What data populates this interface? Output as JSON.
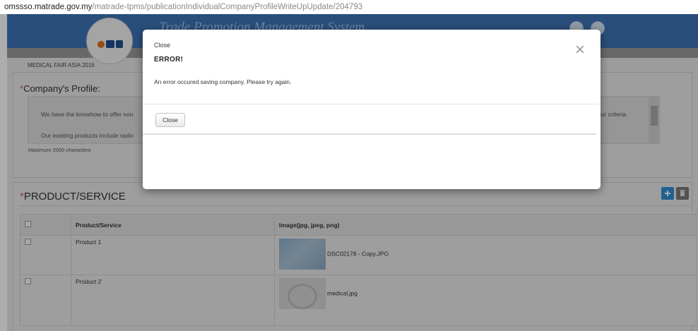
{
  "browser": {
    "url_host": "omssso.matrade.gov.my",
    "url_path": "/matrade-tpms/publicationIndividualCompanyProfileWriteUpUpdate/204793"
  },
  "header": {
    "title": "Trade Promotion Management System"
  },
  "colors": {
    "header_blue": "#3f73b6",
    "required_red": "#d9534f",
    "add_button": "#2e8fd6",
    "delete_button": "#7a7a7a"
  },
  "profile": {
    "event_name": "MEDICAL FAIR ASIA 2016",
    "required_mark": "*",
    "label": "Company's Profile:",
    "lines": [
      "We have the knowhow to offer non",
      "our criteria.",
      "Our existing products include radio"
    ],
    "max_chars": "Maximum 2000 characters"
  },
  "products": {
    "required_mark": "*",
    "title": "PRODUCT/SERVICE",
    "columns": [
      "Product/Service",
      "Image(jpg, jpeg, png)"
    ],
    "rows": [
      {
        "name": "Product 1",
        "image_file": "DSC02178 - Copy.JPG"
      },
      {
        "name": "Product 2",
        "image_file": "medical.jpg"
      }
    ],
    "add_icon": "plus-icon",
    "delete_icon": "trash-icon"
  },
  "modal": {
    "title": "Close",
    "close_icon": "×",
    "heading": "ERROR!",
    "message": "An error occured saving company. Please try again.",
    "close_button": "Close"
  }
}
